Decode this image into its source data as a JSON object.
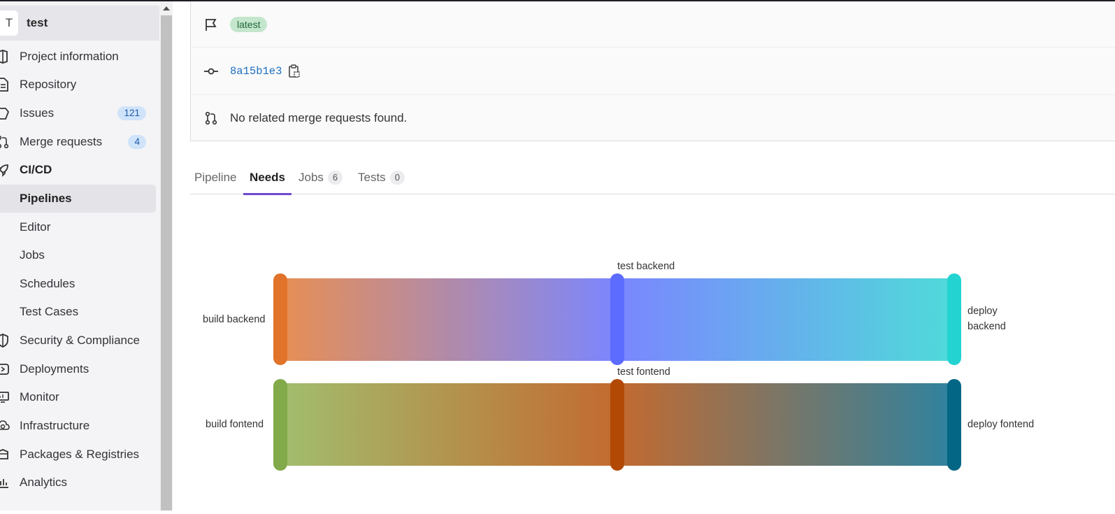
{
  "project": {
    "avatar_letter": "T",
    "name": "test"
  },
  "sidebar": {
    "items": [
      {
        "label": "Project information",
        "icon": "project-info-icon"
      },
      {
        "label": "Repository",
        "icon": "repository-icon"
      },
      {
        "label": "Issues",
        "icon": "issues-icon",
        "count": "121"
      },
      {
        "label": "Merge requests",
        "icon": "merge-request-icon",
        "count": "4"
      },
      {
        "label": "CI/CD",
        "icon": "rocket-icon"
      },
      {
        "label": "Pipelines"
      },
      {
        "label": "Editor"
      },
      {
        "label": "Jobs"
      },
      {
        "label": "Schedules"
      },
      {
        "label": "Test Cases"
      },
      {
        "label": "Security & Compliance",
        "icon": "shield-icon"
      },
      {
        "label": "Deployments",
        "icon": "deployments-icon"
      },
      {
        "label": "Monitor",
        "icon": "monitor-icon"
      },
      {
        "label": "Infrastructure",
        "icon": "cloud-gear-icon"
      },
      {
        "label": "Packages & Registries",
        "icon": "package-icon"
      },
      {
        "label": "Analytics",
        "icon": "chart-icon"
      }
    ],
    "active_item": "Pipelines"
  },
  "pipeline_info": {
    "ref_badge": "latest",
    "commit_sha": "8a15b1e3",
    "merge_requests_text": "No related merge requests found."
  },
  "tabs": [
    {
      "label": "Pipeline"
    },
    {
      "label": "Needs",
      "active": true
    },
    {
      "label": "Jobs",
      "count": "6"
    },
    {
      "label": "Tests",
      "count": "0"
    }
  ],
  "needs_graph": {
    "nodes": {
      "build_backend": {
        "label": "build backend",
        "color": "#e1732a"
      },
      "build_fontend": {
        "label": "build fontend",
        "color": "#82aa4a"
      },
      "test_backend": {
        "label": "test backend",
        "color": "#5c6cff"
      },
      "test_fontend": {
        "label": "test fontend",
        "color": "#b24a05"
      },
      "deploy_backend": {
        "label": "deploy backend",
        "label_lines": [
          "deploy",
          "backend"
        ],
        "color": "#22d3d1"
      },
      "deploy_fontend": {
        "label": "deploy fontend",
        "color": "#036685"
      }
    },
    "links": [
      {
        "from": "build_backend",
        "to": "test_backend",
        "from_color": "#e88f53",
        "to_color": "#7b86ff"
      },
      {
        "from": "test_backend",
        "to": "deploy_backend",
        "from_color": "#7b86ff",
        "to_color": "#4fdbd9"
      },
      {
        "from": "build_fontend",
        "to": "test_fontend",
        "from_color": "#a1be6e",
        "to_color": "#c36a30"
      },
      {
        "from": "test_fontend",
        "to": "deploy_fontend",
        "from_color": "#c36a30",
        "to_color": "#2e82a0"
      }
    ]
  }
}
